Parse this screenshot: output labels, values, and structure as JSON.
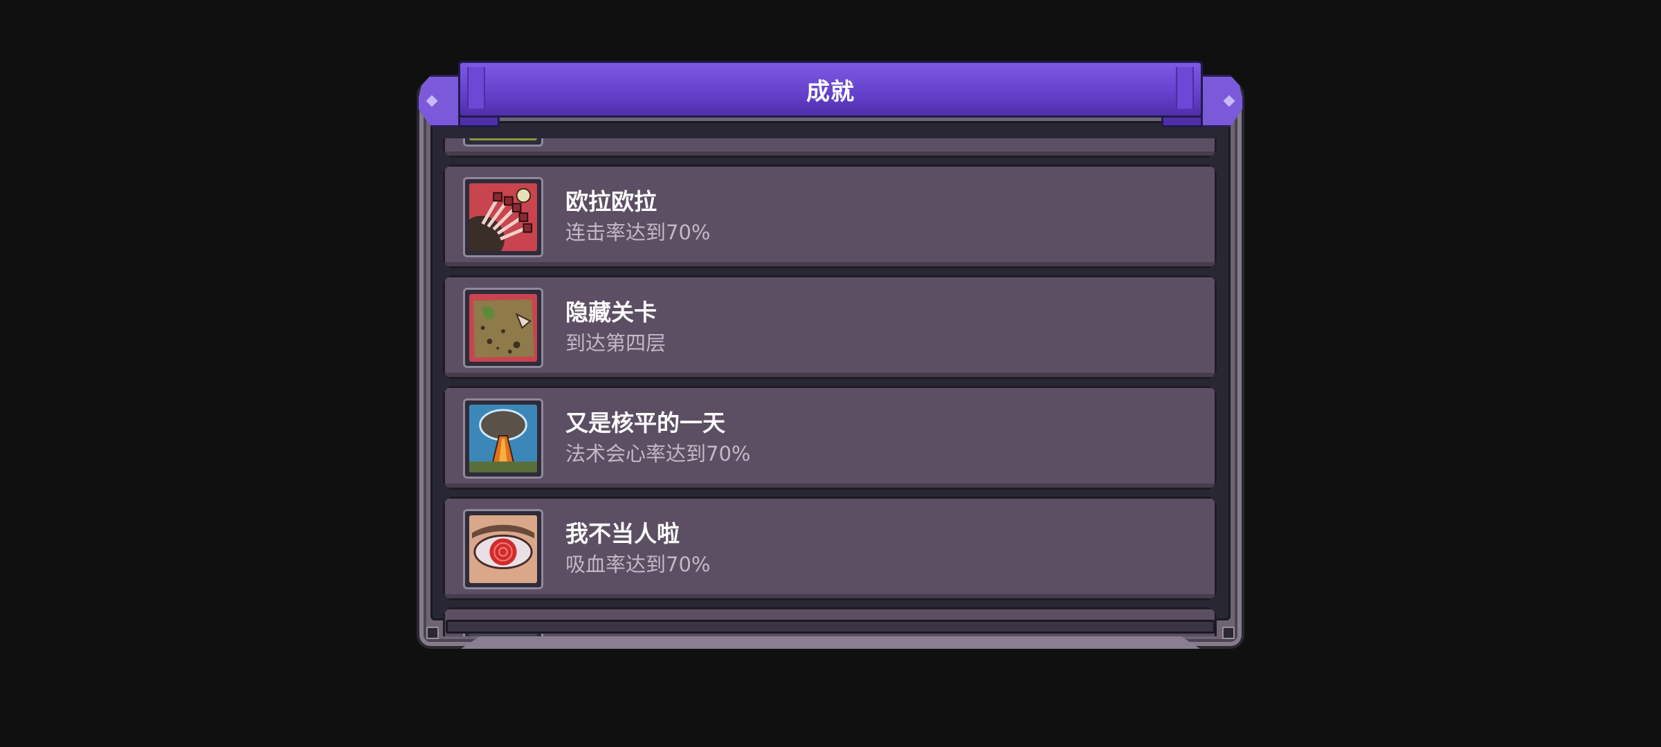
{
  "header": {
    "title": "成就"
  },
  "achievements": [
    {
      "title": "",
      "desc": "",
      "icon": "partial-achievement-icon"
    },
    {
      "title": "欧拉欧拉",
      "desc": "连击率达到70%",
      "icon": "rapid-punch-icon"
    },
    {
      "title": "隐藏关卡",
      "desc": "到达第四层",
      "icon": "map-icon"
    },
    {
      "title": "又是核平的一天",
      "desc": "法术会心率达到70%",
      "icon": "mushroom-cloud-icon"
    },
    {
      "title": "我不当人啦",
      "desc": "吸血率达到70%",
      "icon": "red-eye-icon"
    },
    {
      "title": "",
      "desc": "",
      "icon": "partial-achievement-icon"
    }
  ],
  "colors": {
    "banner": "#5e3cc4",
    "row": "#5d4f63",
    "frame": "#6e6473",
    "background": "#101010"
  }
}
